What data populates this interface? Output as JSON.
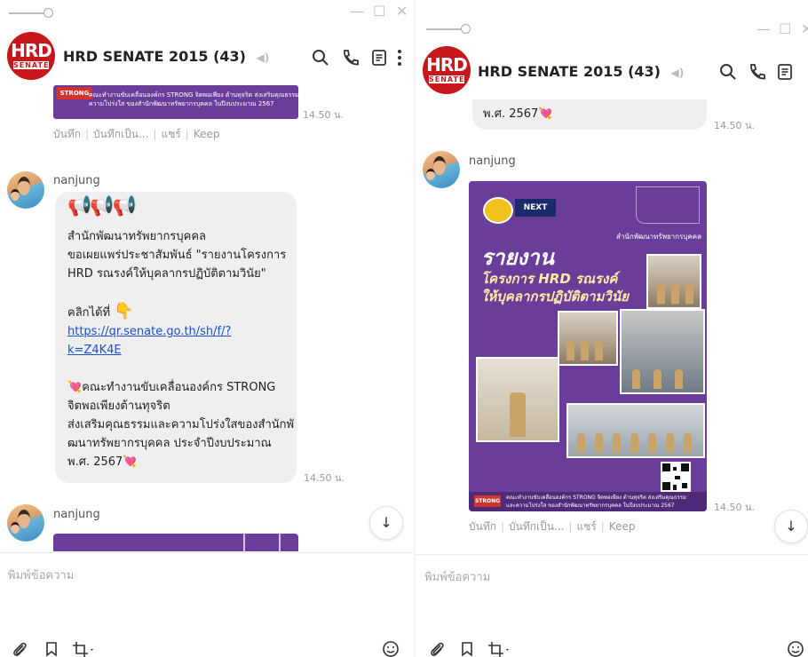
{
  "chat": {
    "title": "HRD SENATE 2015",
    "member_count": "(43)",
    "logo_top": "HRD",
    "logo_bottom": "SENATE",
    "sender": "nanjung",
    "time": "14.50 น.",
    "actions": [
      "บันทึก",
      "บันทึกเป็น...",
      "แชร์",
      "Keep"
    ],
    "message_lines": [
      "สำนักพัฒนาทรัพยากรบุคคล",
      "ขอเผยแพร่ประชาสัมพันธ์ \"รายงานโครงการ",
      "HRD รณรงค์ให้บุคลากรปฏิบัติตามวินัย\"",
      "",
      "คลิกได้ที่"
    ],
    "link_line1": "https://qr.senate.go.th/sh/f/?",
    "link_line2": "k=Z4K4E",
    "closing_lines": [
      "คณะทำงานขับเคลื่อนองค์กร STRONG",
      "จิตพอเพียงต้านทุจริต",
      "ส่งเสริมคุณธรรมและความโปร่งใสของสำนักพั",
      "ฒนาทรัพยากรบุคคล ประจำปีงบประมาณ",
      "พ.ศ. 2567"
    ],
    "right_partial_line": "พ.ศ. 2567",
    "strip_text_line1": "คณะทำงานขับเคลื่อนองค์กร STRONG จิตพอเพียง ต้านทุจริต ส่งเสริมคุณธรรมและ",
    "strip_text_line2": "ความโปร่งใส ของสำนักพัฒนาทรัพยากรบุคคล ในปีงบประมาณ 2567",
    "strip_badge": "STRONG",
    "poster": {
      "badge_left": "ภาพ",
      "badge_right": "NEXT",
      "org": "สำนักพัฒนาทรัพยากรบุคคล",
      "headline1": "รายงาน",
      "headline2": "โครงการ HRD รณรงค์",
      "headline3": "ให้บุคลากรปฏิบัติตามวินัย",
      "footer1": "คณะทำงานขับเคลื่อนองค์กร STRONG จิตพอเพียง ต้านทุจริต ส่งเสริมคุณธรรม",
      "footer2": "และความโปร่งใส ของสำนักพัฒนาทรัพยากรบุคคล ในปีงบประมาณ 2567"
    },
    "compose_placeholder": "พิมพ์ข้อความ"
  }
}
